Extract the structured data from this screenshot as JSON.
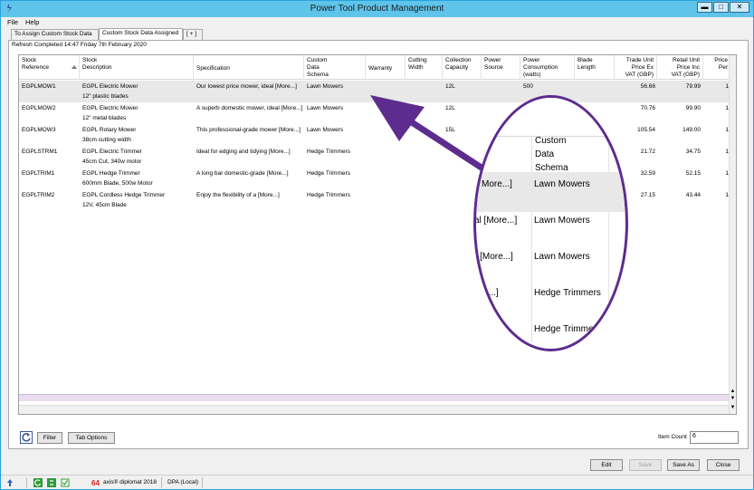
{
  "window": {
    "title": "Power Tool Product Management"
  },
  "menu": [
    "File",
    "Help"
  ],
  "tabs": [
    "To Assign Custom Stock Data",
    "Custom Stock Data Assigned",
    "[ + ]"
  ],
  "refresh_status": "Refresh Completed 14:47 Friday 7th February 2020",
  "columns": [
    "Stock\nReference",
    "Stock\nDescription",
    "Specification",
    "Custom\nData\nSchema",
    "Warranty",
    "Cutting\nWidth",
    "Collection\nCapacity",
    "Power\nSource",
    "Power\nConsumption\n(watts)",
    "Blade\nLength",
    "Trade Unit\nPrice Ex\nVAT (GBP)",
    "Retail Unit\nPrice Inc\nVAT (GBP)",
    "Price\nPer"
  ],
  "rows": [
    {
      "ref": "EGPLMOW1",
      "desc1": "EGPL Electric Mower",
      "desc2": "12\" plastic blades",
      "spec": "Our lowest price mower, ideal [More...]",
      "schema": "Lawn Mowers",
      "capacity": "12L",
      "power": "500",
      "trade": "56.66",
      "retail": "79.99",
      "per": "1"
    },
    {
      "ref": "EGPLMOW2",
      "desc1": "EGPL Electric Mower",
      "desc2": "12\" metal blades",
      "spec": "A superb domestic mower, ideal [More...]",
      "schema": "Lawn Mowers",
      "capacity": "12L",
      "power": "",
      "trade": "70.76",
      "retail": "99.90",
      "per": "1"
    },
    {
      "ref": "EGPLMOW3",
      "desc1": "EGPL Rotary Mower",
      "desc2": "38cm cutting width",
      "spec": "This professional-grade mower [More...]",
      "schema": "Lawn Mowers",
      "capacity": "15L",
      "power": "",
      "trade": "105.54",
      "retail": "149.00",
      "per": "1"
    },
    {
      "ref": "EGPLSTRM1",
      "desc1": "EGPL Electric Trimmer",
      "desc2": "45cm Cut, 340w motor",
      "spec": "Ideal for edging and tidying [More...]",
      "schema": "Hedge Trimmers",
      "capacity": "",
      "power": "",
      "trade": "21.72",
      "retail": "34.75",
      "per": "1"
    },
    {
      "ref": "EGPLTRIM1",
      "desc1": "EGPL Hedge Trimmer",
      "desc2": "600mm Blade, 500w Motor",
      "spec": "A long bar domestic-grade [More...]",
      "schema": "Hedge Trimmers",
      "capacity": "",
      "power": "",
      "trade": "32.59",
      "retail": "52.15",
      "per": "1"
    },
    {
      "ref": "EGPLTRIM2",
      "desc1": "EGPL Cordless Hedge Trimmer",
      "desc2": "12V, 45cm Blade",
      "spec": "Enjoy the flexibility of a [More...]",
      "schema": "Hedge Trimmers",
      "capacity": "",
      "power": "",
      "trade": "27.15",
      "retail": "43.44",
      "per": "1"
    }
  ],
  "buttons": {
    "filter": "Filter",
    "tab_options": "Tab Options",
    "edit": "Edit",
    "save": "Save",
    "save_as": "Save As",
    "close": "Close"
  },
  "item_count": {
    "label": "Item Count",
    "value": "6"
  },
  "statusbar": {
    "product": "axis® diplomat 2018",
    "server": "DPA (Local)"
  },
  "zoom": {
    "header": "Custom\nData\nSchema",
    "left_texts": [
      "More...]",
      "al [More...]",
      "r [More...]",
      "e...]"
    ],
    "schemas": [
      "Lawn Mowers",
      "Lawn Mowers",
      "Lawn Mowers",
      "Hedge Trimmers",
      "Hedge Trimmers"
    ]
  },
  "colors": {
    "accent_titlebar": "#5fc4ea",
    "callout": "#5d2c8e"
  }
}
